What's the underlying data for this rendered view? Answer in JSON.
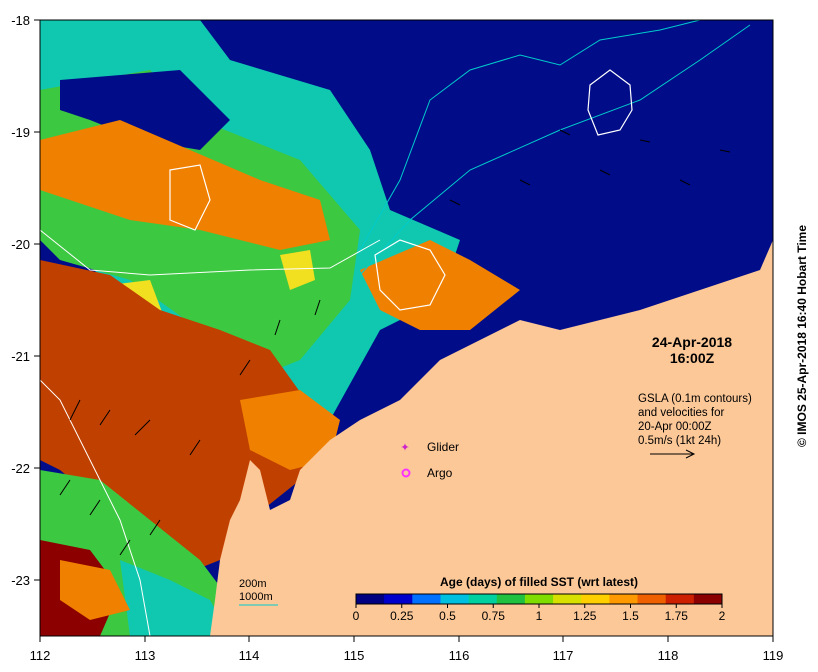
{
  "map": {
    "date": "24-Apr-2018",
    "time": "16:00Z",
    "gsla_note": [
      "GSLA (0.1m contours)",
      "and velocities for",
      "20-Apr 00:00Z",
      "0.5m/s (1kt 24h)"
    ],
    "credit": "© IMOS 25-Apr-2018 16:40 Hobart Time",
    "x_ticks": [
      "112",
      "113",
      "114",
      "115",
      "116",
      "117",
      "118",
      "119"
    ],
    "y_ticks": [
      "-18",
      "-19",
      "-20",
      "-21",
      "-22",
      "-23"
    ],
    "lon_range": [
      112,
      119
    ],
    "lat_range": [
      -23.5,
      -18
    ],
    "legend": {
      "glider_label": "Glider",
      "argo_label": "Argo",
      "glider_color": "#cc22cc",
      "argo_color": "#ff33ff"
    },
    "bathymetry": {
      "label_200": "200m",
      "label_1000": "1000m",
      "color_200": "#ffffff",
      "color_1000": "#00cccc"
    },
    "colorbar": {
      "title": "Age (days) of filled SST (wrt latest)",
      "ticks": [
        "0",
        "0.25",
        "0.5",
        "0.75",
        "1",
        "1.25",
        "1.5",
        "1.75",
        "2"
      ],
      "colors": [
        "#000080",
        "#0000cd",
        "#0070ff",
        "#00c0e0",
        "#00d0a0",
        "#20c040",
        "#80dd00",
        "#d8e000",
        "#ffd000",
        "#ff9900",
        "#ee6000",
        "#cc2000",
        "#8b0000"
      ]
    },
    "colors": {
      "ocean_deep": "#000c88",
      "land": "#fcc898",
      "age_teal": "#10c8b0",
      "age_green": "#3cc840",
      "age_yellow": "#f0e020",
      "age_orange": "#f08000",
      "age_rust": "#c04000",
      "age_dark": "#8c0000"
    }
  }
}
